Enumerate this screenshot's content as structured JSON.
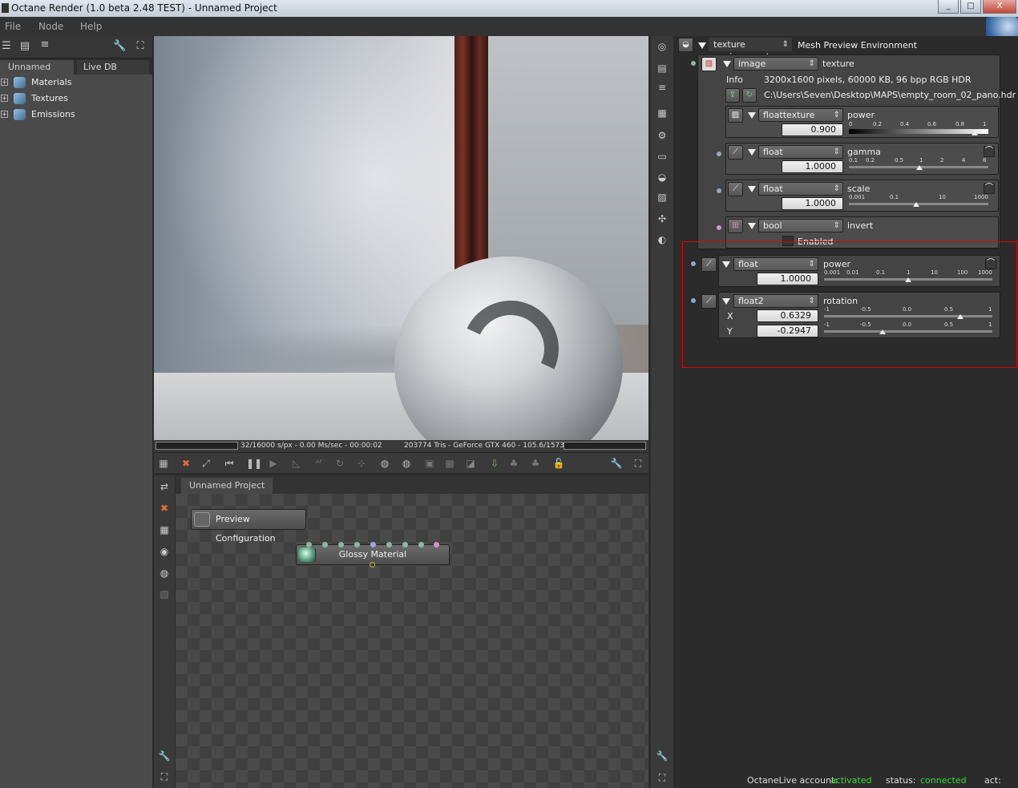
{
  "window": {
    "title": "Octane Render (1.0 beta 2.48 TEST) - Unnamed Project",
    "minimize": "_",
    "maximize": "□",
    "close": "X"
  },
  "menu": {
    "file": "File",
    "node": "Node",
    "help": "Help"
  },
  "left_panel": {
    "tabs": [
      "Unnamed Project",
      "Live DB"
    ],
    "tree": [
      {
        "label": "Materials",
        "expander": "+"
      },
      {
        "label": "Textures",
        "expander": "+"
      },
      {
        "label": "Emissions",
        "expander": "+"
      }
    ]
  },
  "render": {
    "stats_left": "32/16000 s/px - 0.00 Ms/sec - 00:00:02",
    "stats_right": "203774 Tris - GeForce GTX 460 - 105.6/1573 MB"
  },
  "graph": {
    "tab": "Unnamed Project",
    "nodes": [
      "Preview Configuration",
      "Glossy Material"
    ],
    "pin_colors": [
      "#8fb89a",
      "#8fb89a",
      "#8fb89a",
      "#8fb89a",
      "#9aa8d8",
      "#8fb89a",
      "#8fb89a",
      "#8fb89a",
      "#d88fd0"
    ]
  },
  "inspector": {
    "env": {
      "type": "texture environment",
      "name": "Mesh Preview Environment"
    },
    "image": {
      "type": "image",
      "name": "texture",
      "info_label": "Info",
      "info": "3200x1600 pixels, 60000 KB, 96 bpp RGB HDR",
      "path": "C:\\Users\\Seven\\Desktop\\MAPS\\empty_room_02_pano.hdr"
    },
    "power_tex": {
      "type": "floattexture",
      "name": "power",
      "value": "0.900",
      "slider": 0.9,
      "scale": [
        "0",
        "0.2",
        "0.4",
        "0.6",
        "0.8",
        "1"
      ]
    },
    "gamma": {
      "type": "float",
      "name": "gamma",
      "value": "1.0000",
      "scale": [
        "0.1",
        "0.2",
        "0.5",
        "1",
        "2",
        "4",
        "8"
      ]
    },
    "scale": {
      "type": "float",
      "name": "scale",
      "value": "1.0000",
      "scale": [
        "0.001",
        "0.1",
        "10",
        "1000"
      ]
    },
    "invert": {
      "type": "bool",
      "name": "invert",
      "checkbox": "Enabled"
    },
    "env_power": {
      "type": "float",
      "name": "power",
      "value": "1.0000",
      "scale": [
        "0.001",
        "0.01",
        "0.1",
        "1",
        "10",
        "100",
        "1000"
      ]
    },
    "rotation": {
      "type": "float2",
      "name": "rotation",
      "x_label": "X",
      "x": "0.6329",
      "y_label": "Y",
      "y": "-0.2947",
      "scale": [
        "-1",
        "-0.5",
        "0.0",
        "0.5",
        "1"
      ]
    }
  },
  "footer": {
    "account_label": "OctaneLive account:",
    "account_value": "activated",
    "status_label": "status:",
    "status_value": "connected",
    "act_label": "act:"
  },
  "colors": {
    "status_green": "#33dd33",
    "highlight": "#e00000"
  }
}
